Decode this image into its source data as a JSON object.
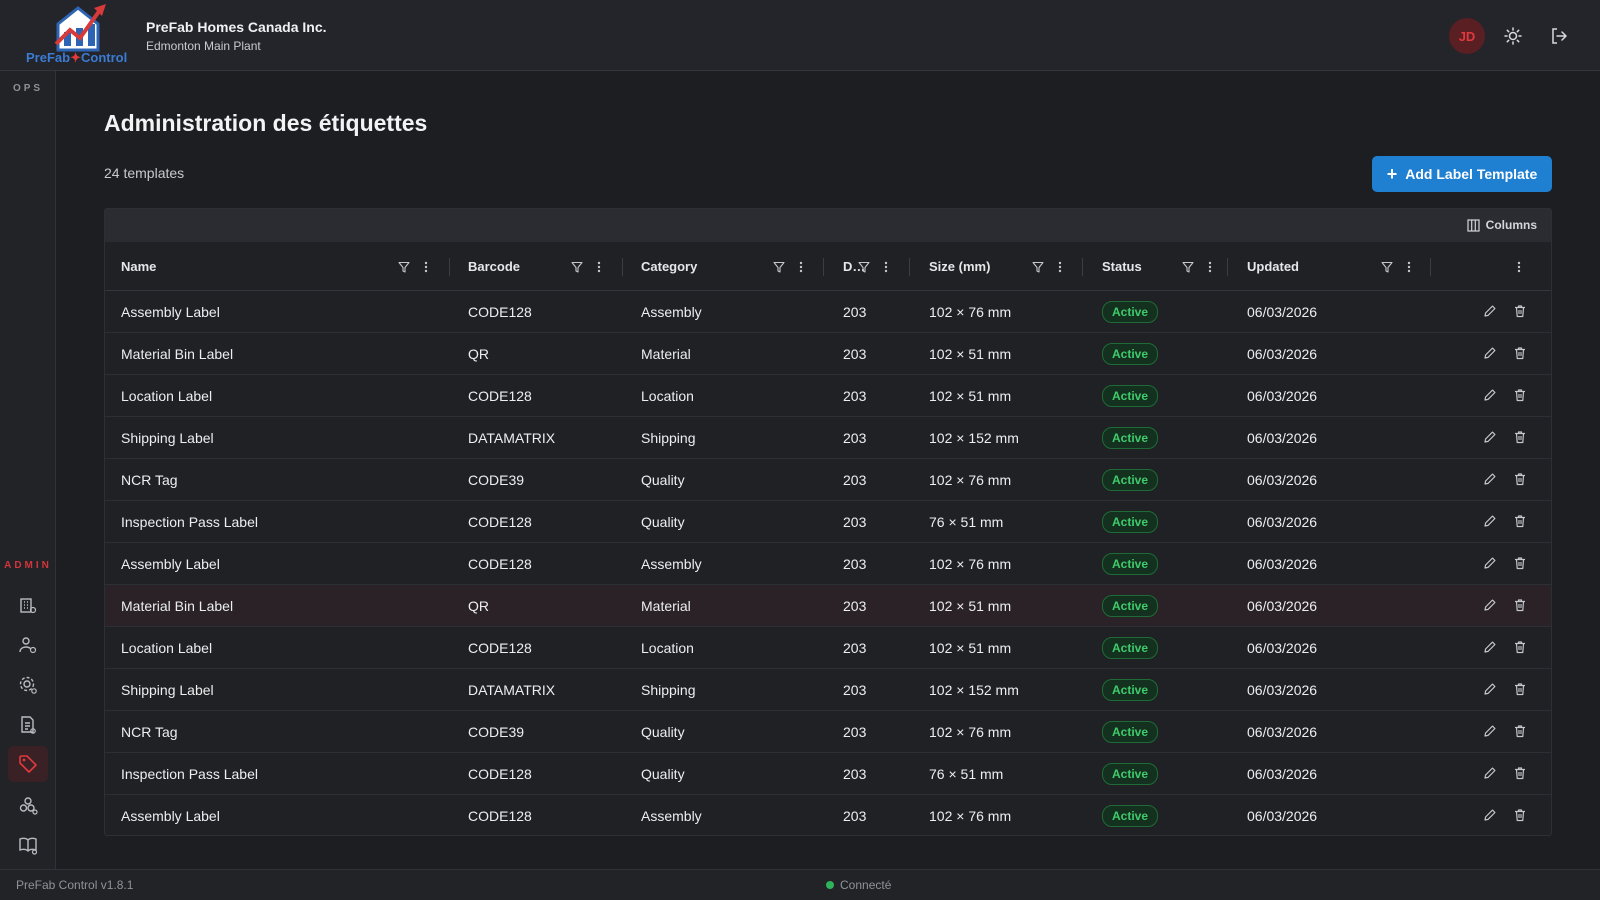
{
  "app": {
    "logo_prefix": "PreFab",
    "logo_star": "✦",
    "logo_suffix": "Control",
    "company_name": "PreFab Homes Canada Inc.",
    "site_name": "Edmonton Main Plant",
    "user_initials": "JD",
    "accent_color": "#1f7fd1",
    "brand_red": "#d2353b"
  },
  "sidebar": {
    "ops_label": "OPS",
    "admin_label": "ADMIN",
    "items": [
      {
        "icon": "building-settings-icon"
      },
      {
        "icon": "users-settings-icon"
      },
      {
        "icon": "gear-settings-icon"
      },
      {
        "icon": "document-settings-icon"
      },
      {
        "icon": "tag-icon",
        "active": true
      },
      {
        "icon": "cubes-settings-icon"
      },
      {
        "icon": "book-settings-icon"
      }
    ]
  },
  "page": {
    "title": "Administration des étiquettes",
    "count": "24 templates",
    "add_button": "Add Label Template"
  },
  "grid": {
    "columns_button": "Columns",
    "headers": [
      "Name",
      "Barcode",
      "Category",
      "D…",
      "Size (mm)",
      "Status",
      "Updated"
    ],
    "rows": [
      {
        "name": "Assembly Label",
        "barcode": "CODE128",
        "category": "Assembly",
        "dpi": "203",
        "size": "102 × 76 mm",
        "status": "Active",
        "updated": "06/03/2026"
      },
      {
        "name": "Material Bin Label",
        "barcode": "QR",
        "category": "Material",
        "dpi": "203",
        "size": "102 × 51 mm",
        "status": "Active",
        "updated": "06/03/2026"
      },
      {
        "name": "Location Label",
        "barcode": "CODE128",
        "category": "Location",
        "dpi": "203",
        "size": "102 × 51 mm",
        "status": "Active",
        "updated": "06/03/2026"
      },
      {
        "name": "Shipping Label",
        "barcode": "DATAMATRIX",
        "category": "Shipping",
        "dpi": "203",
        "size": "102 × 152 mm",
        "status": "Active",
        "updated": "06/03/2026"
      },
      {
        "name": "NCR Tag",
        "barcode": "CODE39",
        "category": "Quality",
        "dpi": "203",
        "size": "102 × 76 mm",
        "status": "Active",
        "updated": "06/03/2026"
      },
      {
        "name": "Inspection Pass Label",
        "barcode": "CODE128",
        "category": "Quality",
        "dpi": "203",
        "size": "76 × 51 mm",
        "status": "Active",
        "updated": "06/03/2026"
      },
      {
        "name": "Assembly Label",
        "barcode": "CODE128",
        "category": "Assembly",
        "dpi": "203",
        "size": "102 × 76 mm",
        "status": "Active",
        "updated": "06/03/2026"
      },
      {
        "name": "Material Bin Label",
        "barcode": "QR",
        "category": "Material",
        "dpi": "203",
        "size": "102 × 51 mm",
        "status": "Active",
        "updated": "06/03/2026",
        "highlighted": true
      },
      {
        "name": "Location Label",
        "barcode": "CODE128",
        "category": "Location",
        "dpi": "203",
        "size": "102 × 51 mm",
        "status": "Active",
        "updated": "06/03/2026"
      },
      {
        "name": "Shipping Label",
        "barcode": "DATAMATRIX",
        "category": "Shipping",
        "dpi": "203",
        "size": "102 × 152 mm",
        "status": "Active",
        "updated": "06/03/2026"
      },
      {
        "name": "NCR Tag",
        "barcode": "CODE39",
        "category": "Quality",
        "dpi": "203",
        "size": "102 × 76 mm",
        "status": "Active",
        "updated": "06/03/2026"
      },
      {
        "name": "Inspection Pass Label",
        "barcode": "CODE128",
        "category": "Quality",
        "dpi": "203",
        "size": "76 × 51 mm",
        "status": "Active",
        "updated": "06/03/2026"
      },
      {
        "name": "Assembly Label",
        "barcode": "CODE128",
        "category": "Assembly",
        "dpi": "203",
        "size": "102 × 76 mm",
        "status": "Active",
        "updated": "06/03/2026"
      }
    ]
  },
  "footer": {
    "version": "PreFab Control v1.8.1",
    "connection": "Connecté"
  }
}
